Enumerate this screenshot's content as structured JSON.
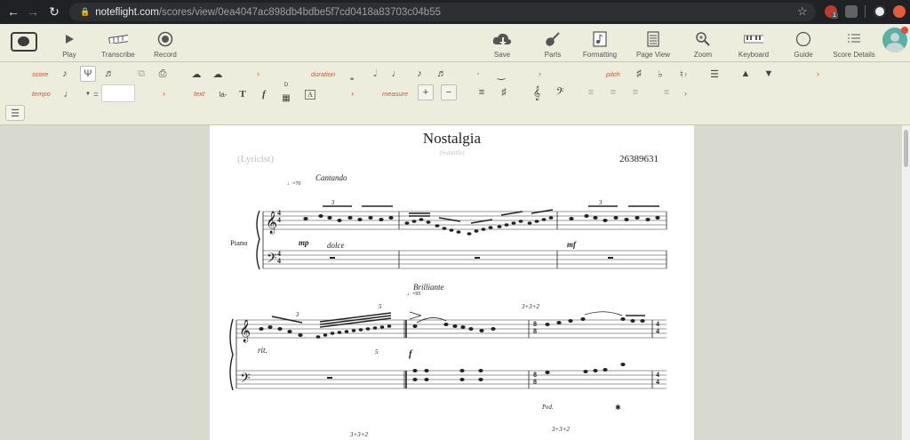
{
  "browser": {
    "url_host": "noteflight.com",
    "url_path": "/scores/view/0ea4047ac898db4bdbe5f7cd0418a83703c04b55",
    "ext_badge": "1"
  },
  "toolbar": {
    "play": "Play",
    "transcribe": "Transcribe",
    "record": "Record",
    "save": "Save",
    "parts": "Parts",
    "formatting": "Formatting",
    "page_view": "Page View",
    "zoom": "Zoom",
    "keyboard": "Keyboard",
    "guide": "Guide",
    "score_details": "Score Details"
  },
  "palette": {
    "score": "score",
    "duration": "duration",
    "pitch": "pitch",
    "tempo": "tempo",
    "text": "text",
    "measure": "measure",
    "lyric_label": "la-",
    "text_T": "T",
    "dynamic_f": "f",
    "chord_D": "D",
    "boxed_A": "A",
    "equals": "=",
    "tempo_value": ""
  },
  "score": {
    "title": "Nostalgia",
    "subtitle": "(Subtitle)",
    "lyricist": "(Lyricist)",
    "composer": "26389631",
    "instrument": "Piano",
    "cantando": "Cantando",
    "tempo1": "=70",
    "triplet": "3",
    "mp": "mp",
    "dolce": "dolce",
    "mf": "mf",
    "brilliante": "Brilliante",
    "tempo2": "=95",
    "rit": "rit.",
    "five": "5",
    "f": "f",
    "meter_label": "3+3+2",
    "ped": "Ped.",
    "time_sig_top": "4",
    "time_sig_bottom": "4",
    "time_sig2_top": "8",
    "time_sig2_bottom": "8"
  },
  "colors": {
    "accent": "#e0502a",
    "chrome": "#202124",
    "toolbar": "#ededde",
    "page": "#ffffff",
    "background": "#d8d9cf"
  }
}
